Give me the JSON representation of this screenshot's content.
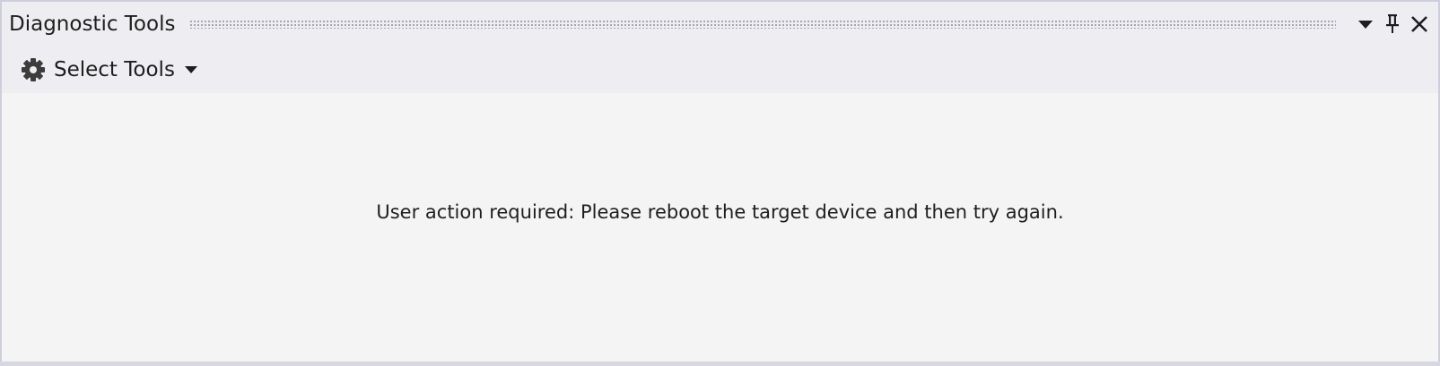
{
  "window": {
    "title": "Diagnostic Tools"
  },
  "title_buttons": [
    {
      "icon": "chevron-down-icon",
      "label": "Window position menu"
    },
    {
      "icon": "pin-icon",
      "label": "Auto hide"
    },
    {
      "icon": "close-icon",
      "label": "Close"
    }
  ],
  "toolbar": {
    "select_tools_label": "Select Tools",
    "select_tools_icon": "gear-icon"
  },
  "content": {
    "message": "User action required: Please reboot the target device and then try again."
  },
  "colors": {
    "titlebar_bg": "#eeeef2",
    "content_bg": "#f4f4f4",
    "border": "#cccedb",
    "text": "#1e1e1e"
  }
}
